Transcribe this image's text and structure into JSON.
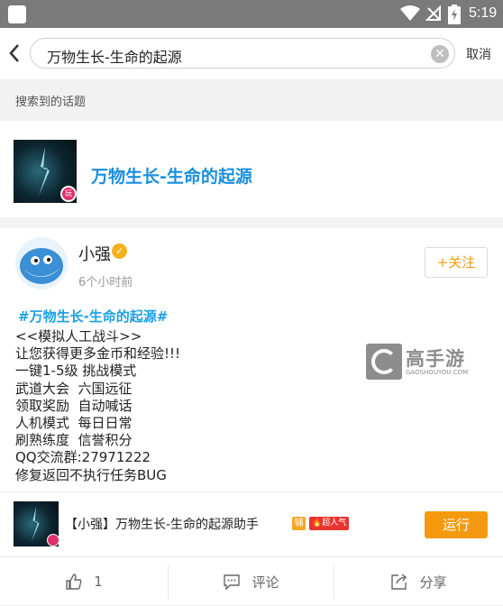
{
  "status_bar": {
    "time": "5:19"
  },
  "search": {
    "query": "万物生长-生命的起源",
    "cancel_label": "取消"
  },
  "section_label": "搜索到的话题",
  "topic": {
    "title": "万物生长-生命的起源",
    "badge": "玩"
  },
  "post": {
    "author": "小强",
    "time": "6个小时前",
    "follow_label": "+关注",
    "tag": "#万物生长-生命的起源#",
    "lines": [
      "<<模拟人工战斗>>",
      "让您获得更多金币和经验!!!",
      "一键1-5级 挑战模式",
      "武道大会  六国远征",
      "领取奖励  自动喊话",
      "人机模式  每日日常",
      "刷熟练度  信誉积分",
      "QQ交流群:27971222",
      "修复返回不执行任务BUG"
    ]
  },
  "watermark": {
    "name": "高手游",
    "url": "GAOSHOUYOU.COM"
  },
  "assistant": {
    "title": "【小强】万物生长-生命的起源助手",
    "fu_badge": "辅",
    "hot_badge": "超人气",
    "run_label": "运行"
  },
  "actions": {
    "like_count": "1",
    "comment_label": "评论",
    "share_label": "分享"
  },
  "colors": {
    "accent_blue": "#1a8fe0",
    "accent_orange": "#f59a10",
    "hot_red": "#e8342f"
  }
}
